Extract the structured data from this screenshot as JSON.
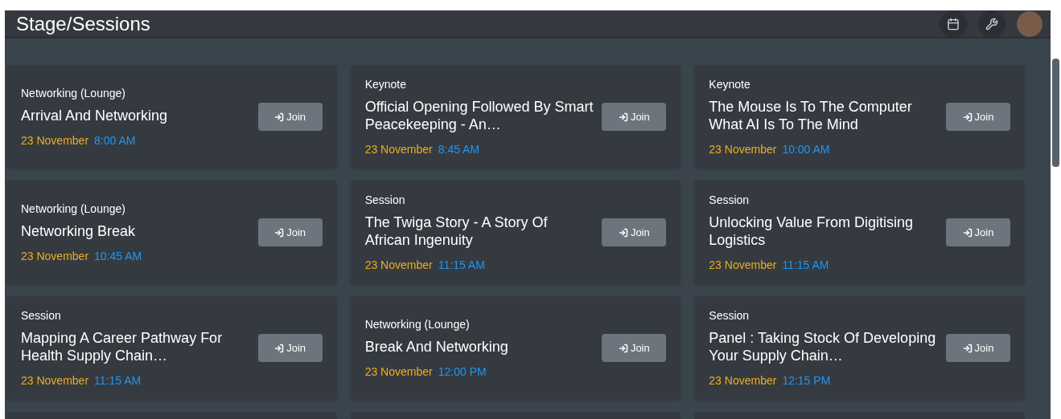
{
  "header": {
    "title": "Stage/Sessions"
  },
  "sessions": [
    {
      "category": "Networking (Lounge)",
      "title": "Arrival And Networking",
      "date": "23 November",
      "time": "8:00 AM",
      "button": "Join"
    },
    {
      "category": "Keynote",
      "title": "Official Opening Followed By Smart Peacekeeping - An…",
      "date": "23 November",
      "time": "8:45 AM",
      "button": "Join"
    },
    {
      "category": "Keynote",
      "title": "The Mouse Is To The Computer What AI Is To The Mind",
      "date": "23 November",
      "time": "10:00 AM",
      "button": "Join"
    },
    {
      "category": "Networking (Lounge)",
      "title": "Networking Break",
      "date": "23 November",
      "time": "10:45 AM",
      "button": "Join"
    },
    {
      "category": "Session",
      "title": "The Twiga Story - A Story Of African Ingenuity",
      "date": "23 November",
      "time": "11:15 AM",
      "button": "Join"
    },
    {
      "category": "Session",
      "title": "Unlocking Value From Digitising Logistics",
      "date": "23 November",
      "time": "11:15 AM",
      "button": "Join"
    },
    {
      "category": "Session",
      "title": "Mapping A Career Pathway For Health Supply Chain…",
      "date": "23 November",
      "time": "11:15 AM",
      "button": "Join"
    },
    {
      "category": "Networking (Lounge)",
      "title": "Break And Networking",
      "date": "23 November",
      "time": "12:00 PM",
      "button": "Join"
    },
    {
      "category": "Session",
      "title": "Panel : Taking Stock Of Developing Your Supply Chain…",
      "date": "23 November",
      "time": "12:15 PM",
      "button": "Join"
    }
  ]
}
